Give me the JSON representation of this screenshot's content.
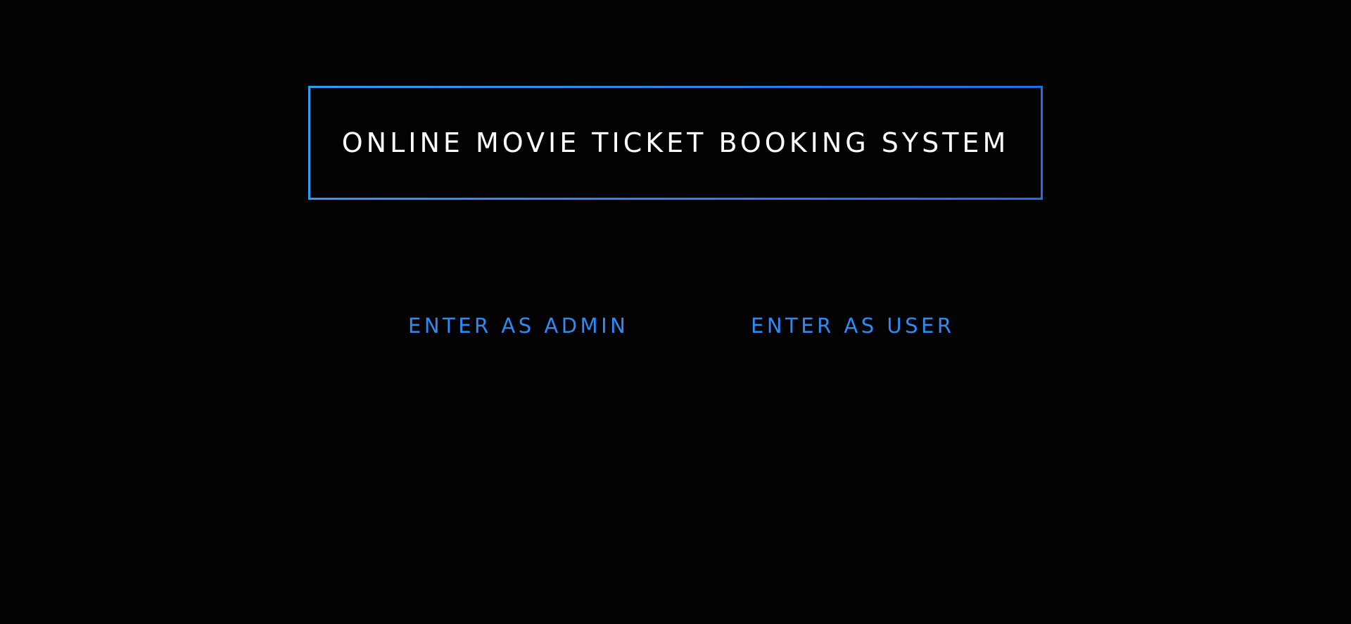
{
  "header": {
    "title": "ONLINE MOVIE TICKET BOOKING SYSTEM"
  },
  "nav": {
    "admin_label": "ENTER AS ADMIN",
    "user_label": "ENTER AS USER"
  },
  "colors": {
    "background": "#020202",
    "accent": "#2d8bf5",
    "title_text": "#ffffff"
  }
}
